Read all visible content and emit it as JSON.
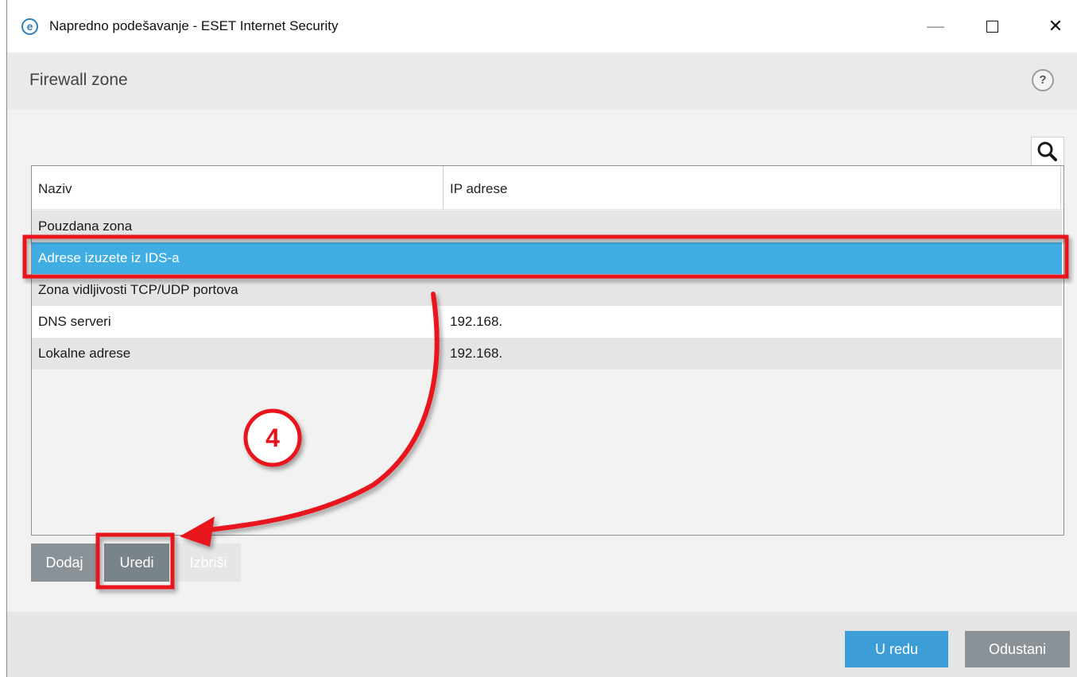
{
  "window": {
    "title": "Napredno podešavanje - ESET Internet Security",
    "logo_letter": "e",
    "controls": {
      "minimize": "—",
      "close": "✕"
    }
  },
  "header": {
    "title": "Firewall zone",
    "help": "?"
  },
  "table": {
    "columns": [
      "Naziv",
      "IP adrese"
    ],
    "rows": [
      {
        "name": "Pouzdana zona",
        "ip": ""
      },
      {
        "name": "Adrese izuzete iz IDS-a",
        "ip": ""
      },
      {
        "name": "Zona vidljivosti TCP/UDP portova",
        "ip": ""
      },
      {
        "name": "DNS serveri",
        "ip": "192.168."
      },
      {
        "name": "Lokalne adrese",
        "ip": "192.168."
      }
    ],
    "selected_row": 1
  },
  "actions": {
    "add": "Dodaj",
    "edit": "Uredi",
    "delete": "Izbriši"
  },
  "footer": {
    "ok": "U redu",
    "cancel": "Odustani"
  },
  "annotation": {
    "step_number": "4"
  },
  "colors": {
    "selected_row": "#41aee3",
    "annotation_red": "#e8141c",
    "primary_button": "#3d9dd7"
  },
  "icons": [
    "eset-logo-icon",
    "minimize-icon",
    "maximize-icon",
    "close-icon",
    "help-icon",
    "search-icon",
    "annotation-arrow-icon"
  ]
}
